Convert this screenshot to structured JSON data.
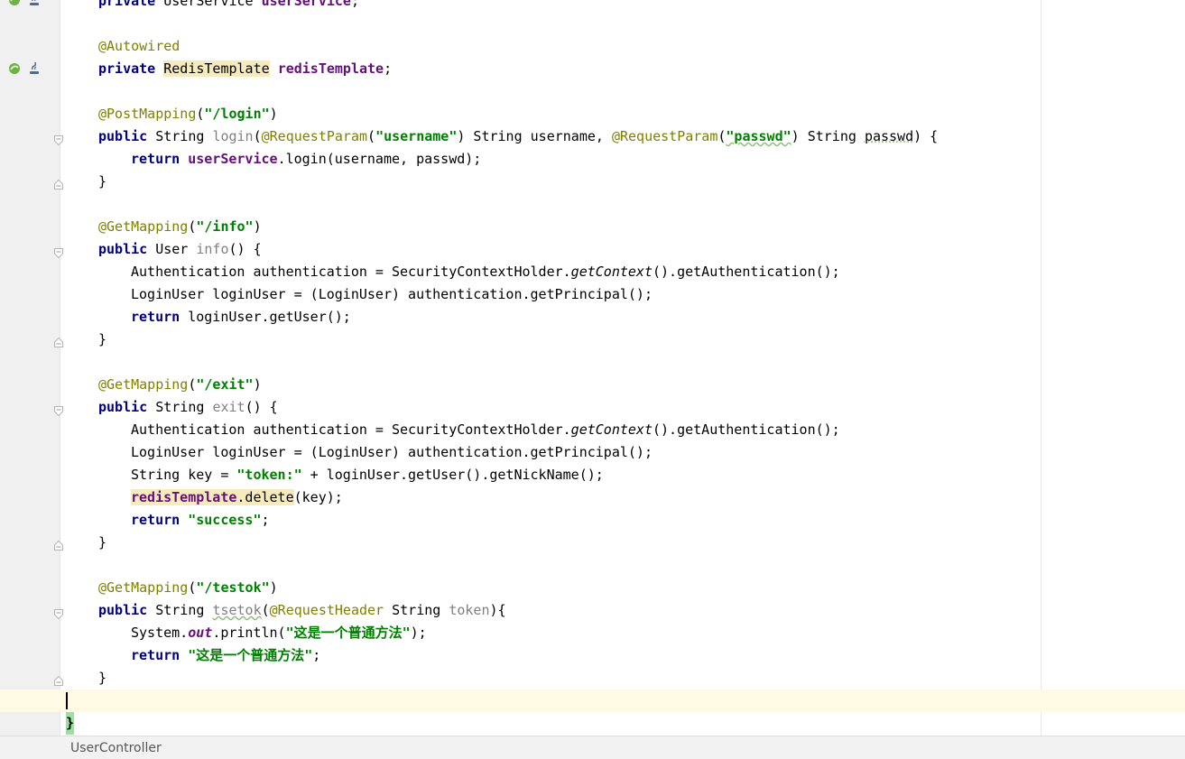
{
  "editor": {
    "lines": [
      {
        "tokens": [
          {
            "t": "private",
            "c": "kw"
          },
          {
            "t": " UserService "
          },
          {
            "t": "userService",
            "c": "fld"
          },
          {
            "t": ";"
          }
        ]
      },
      {
        "tokens": []
      },
      {
        "tokens": [
          {
            "t": "@Autowired",
            "c": "ann"
          }
        ]
      },
      {
        "tokens": [
          {
            "t": "private",
            "c": "kw"
          },
          {
            "t": " "
          },
          {
            "t": "RedisTemplate",
            "c": "hl"
          },
          {
            "t": " "
          },
          {
            "t": "redisTemplate",
            "c": "fld"
          },
          {
            "t": ";"
          }
        ]
      },
      {
        "tokens": []
      },
      {
        "tokens": [
          {
            "t": "@PostMapping",
            "c": "ann"
          },
          {
            "t": "("
          },
          {
            "t": "\"/login\"",
            "c": "str"
          },
          {
            "t": ")"
          }
        ]
      },
      {
        "tokens": [
          {
            "t": "public",
            "c": "kw"
          },
          {
            "t": " String "
          },
          {
            "t": "login",
            "c": "unused"
          },
          {
            "t": "("
          },
          {
            "t": "@RequestParam",
            "c": "ann"
          },
          {
            "t": "("
          },
          {
            "t": "\"username\"",
            "c": "str"
          },
          {
            "t": ") String username, "
          },
          {
            "t": "@RequestParam",
            "c": "ann"
          },
          {
            "t": "("
          },
          {
            "t": "\"passwd\"",
            "c": "str wavy"
          },
          {
            "t": ") String "
          },
          {
            "t": "passwd",
            "c": "dotted"
          },
          {
            "t": ") {"
          }
        ]
      },
      {
        "indent": true,
        "tokens": [
          {
            "t": "return",
            "c": "kw"
          },
          {
            "t": " "
          },
          {
            "t": "userService",
            "c": "fld"
          },
          {
            "t": ".login(username, passwd);"
          }
        ]
      },
      {
        "tokens": [
          {
            "t": "}"
          }
        ]
      },
      {
        "tokens": []
      },
      {
        "tokens": [
          {
            "t": "@GetMapping",
            "c": "ann"
          },
          {
            "t": "("
          },
          {
            "t": "\"/info\"",
            "c": "str"
          },
          {
            "t": ")"
          }
        ]
      },
      {
        "tokens": [
          {
            "t": "public",
            "c": "kw"
          },
          {
            "t": " User "
          },
          {
            "t": "info",
            "c": "unused"
          },
          {
            "t": "() {"
          }
        ]
      },
      {
        "indent": true,
        "tokens": [
          {
            "t": "Authentication authentication = SecurityContextHolder."
          },
          {
            "t": "getContext",
            "c": "ital"
          },
          {
            "t": "().getAuthentication();"
          }
        ]
      },
      {
        "indent": true,
        "tokens": [
          {
            "t": "LoginUser loginUser = (LoginUser) authentication.getPrincipal();"
          }
        ]
      },
      {
        "indent": true,
        "tokens": [
          {
            "t": "return",
            "c": "kw"
          },
          {
            "t": " loginUser.getUser();"
          }
        ]
      },
      {
        "tokens": [
          {
            "t": "}"
          }
        ]
      },
      {
        "tokens": []
      },
      {
        "tokens": [
          {
            "t": "@GetMapping",
            "c": "ann"
          },
          {
            "t": "("
          },
          {
            "t": "\"/exit\"",
            "c": "str"
          },
          {
            "t": ")"
          }
        ]
      },
      {
        "tokens": [
          {
            "t": "public",
            "c": "kw"
          },
          {
            "t": " String "
          },
          {
            "t": "exit",
            "c": "unused"
          },
          {
            "t": "() {"
          }
        ]
      },
      {
        "indent": true,
        "tokens": [
          {
            "t": "Authentication authentication = SecurityContextHolder."
          },
          {
            "t": "getContext",
            "c": "ital"
          },
          {
            "t": "().getAuthentication();"
          }
        ]
      },
      {
        "indent": true,
        "tokens": [
          {
            "t": "LoginUser loginUser = (LoginUser) authentication.getPrincipal();"
          }
        ]
      },
      {
        "indent": true,
        "tokens": [
          {
            "t": "String key = "
          },
          {
            "t": "\"token:\"",
            "c": "str"
          },
          {
            "t": " + loginUser.getUser().getNickName();"
          }
        ]
      },
      {
        "indent": true,
        "tokens": [
          {
            "t": "redisTemplate",
            "c": "fld hl"
          },
          {
            "t": ".delete",
            "c": "hl"
          },
          {
            "t": "(key);"
          }
        ]
      },
      {
        "indent": true,
        "tokens": [
          {
            "t": "return",
            "c": "kw"
          },
          {
            "t": " "
          },
          {
            "t": "\"success\"",
            "c": "str"
          },
          {
            "t": ";"
          }
        ]
      },
      {
        "tokens": [
          {
            "t": "}"
          }
        ]
      },
      {
        "tokens": []
      },
      {
        "tokens": [
          {
            "t": "@GetMapping",
            "c": "ann"
          },
          {
            "t": "("
          },
          {
            "t": "\"/testok\"",
            "c": "str"
          },
          {
            "t": ")"
          }
        ]
      },
      {
        "tokens": [
          {
            "t": "public",
            "c": "kw"
          },
          {
            "t": " String "
          },
          {
            "t": "tsetok",
            "c": "unused wavy"
          },
          {
            "t": "("
          },
          {
            "t": "@RequestHeader",
            "c": "ann"
          },
          {
            "t": " String "
          },
          {
            "t": "token",
            "c": "unused"
          },
          {
            "t": "){"
          }
        ]
      },
      {
        "indent": true,
        "tokens": [
          {
            "t": "System."
          },
          {
            "t": "out",
            "c": "statfld"
          },
          {
            "t": ".println("
          },
          {
            "t": "\"这是一个普通方法\"",
            "c": "str"
          },
          {
            "t": ");"
          }
        ]
      },
      {
        "indent": true,
        "tokens": [
          {
            "t": "return",
            "c": "kw"
          },
          {
            "t": " "
          },
          {
            "t": "\"这是一个普通方法\"",
            "c": "str"
          },
          {
            "t": ";"
          }
        ]
      },
      {
        "tokens": [
          {
            "t": "}"
          }
        ]
      }
    ],
    "closing_brace": "}",
    "gutter_icons": [
      "bean-icon",
      "java-class-icon"
    ]
  },
  "status_bar": {
    "breadcrumb": "UserController"
  }
}
